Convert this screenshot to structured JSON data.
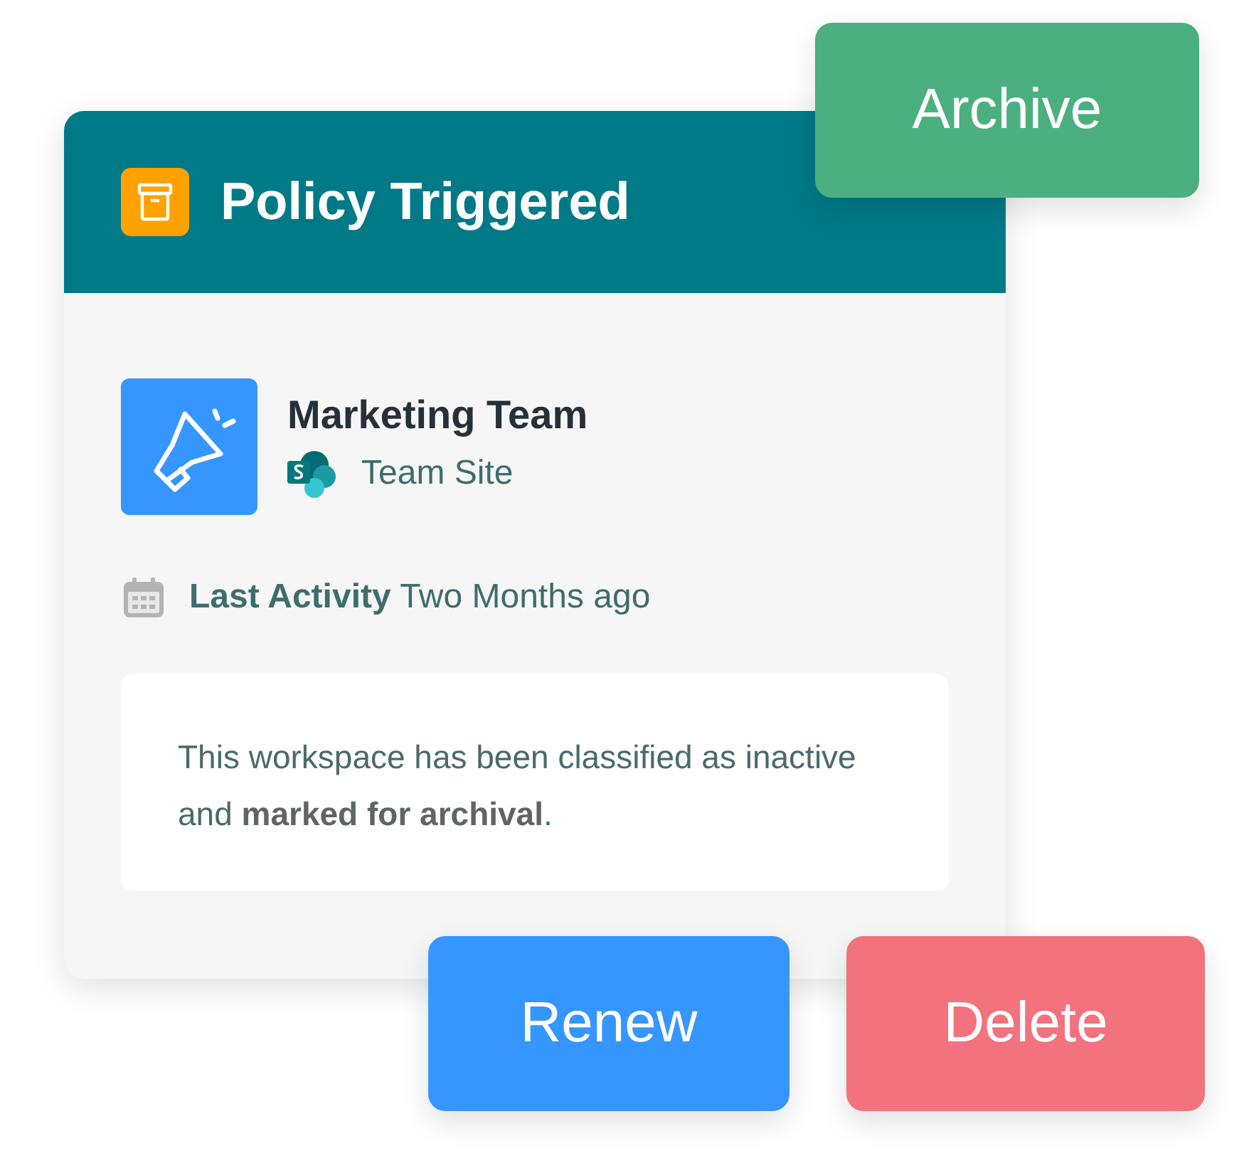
{
  "card": {
    "header": {
      "title": "Policy Triggered"
    },
    "workspace": {
      "name": "Marketing Team",
      "type": "Team Site"
    },
    "activity": "**Last Activity** Two Months ago",
    "message": "This workspace has been classified as inactive and **marked for archival**."
  },
  "actions": [
    {
      "label": "Archive",
      "kind": "archive"
    },
    {
      "label": "Renew",
      "kind": "renew"
    },
    {
      "label": "Delete",
      "kind": "delete"
    }
  ]
}
